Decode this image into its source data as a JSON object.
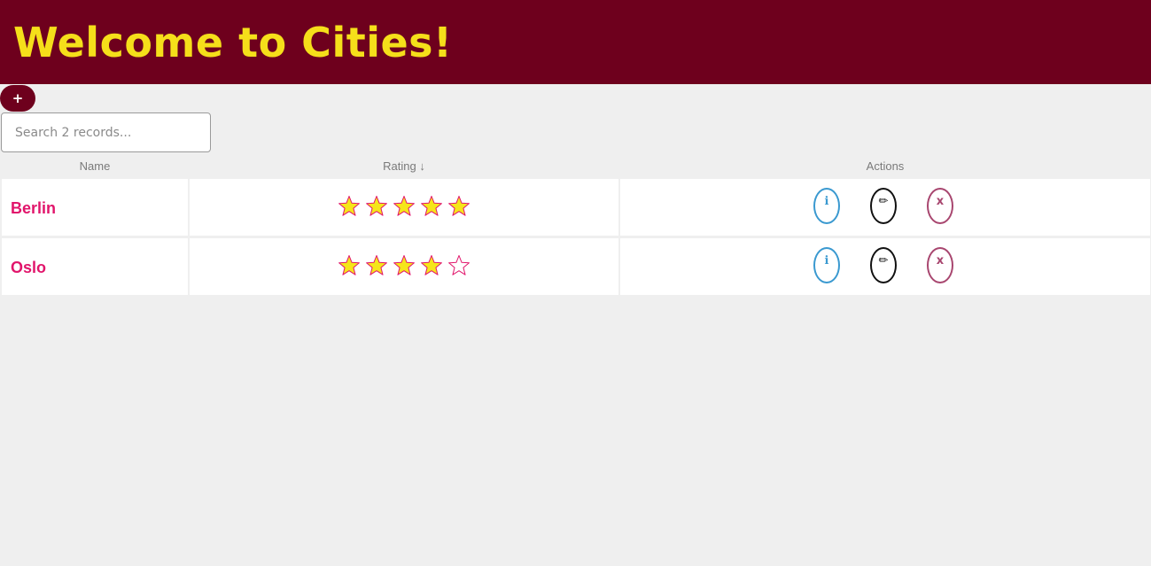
{
  "header": {
    "title": "Welcome to Cities!"
  },
  "toolbar": {
    "add_label": "+",
    "search_placeholder": "Search 2 records..."
  },
  "table": {
    "columns": {
      "name": "Name",
      "rating": "Rating ↓",
      "actions": "Actions"
    },
    "rows": [
      {
        "name": "Berlin",
        "rating": 5,
        "max_rating": 5
      },
      {
        "name": "Oslo",
        "rating": 4,
        "max_rating": 5
      }
    ],
    "actions": {
      "info_glyph": "ℹ",
      "edit_glyph": "✏",
      "delete_glyph": "x"
    }
  },
  "colors": {
    "header_bg": "#6e001d",
    "title": "#f5df1a",
    "city_name": "#e1156b",
    "star_fill": "#f5e61a",
    "star_stroke": "#e1156b",
    "info": "#3a99d0",
    "edit": "#111111",
    "delete": "#a8466f"
  }
}
